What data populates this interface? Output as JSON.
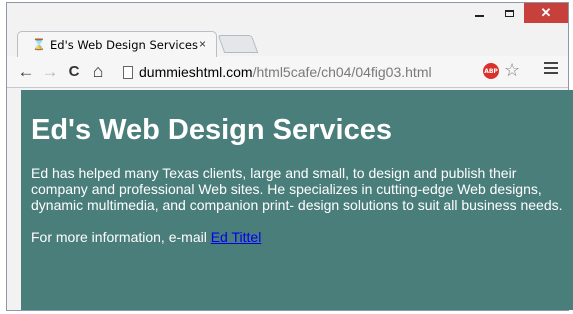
{
  "window": {
    "controls": {
      "minimize": "minimize",
      "maximize": "maximize",
      "close": "✕"
    }
  },
  "tab": {
    "title": "Ed's Web Design Services",
    "close": "×"
  },
  "toolbar": {
    "back": "←",
    "forward": "→",
    "reload": "C",
    "home": "⌂",
    "url_host": "dummieshtml.com",
    "url_path": "/html5cafe/ch04/04fig03.html",
    "adblock_label": "ABP",
    "bookmark_star": "☆"
  },
  "page": {
    "heading": "Ed's Web Design Services",
    "paragraph": "Ed has helped many Texas clients, large and small, to design and publish their company and professional Web sites. He specializes in cutting-edge Web designs, dynamic multimedia, and companion print- design solutions to suit all business needs.",
    "contact_prefix": "For more information, e-mail ",
    "contact_link": "Ed Tittel",
    "background_color": "#4a7e7b",
    "text_color": "#ffffff",
    "link_color": "#0000ee"
  }
}
